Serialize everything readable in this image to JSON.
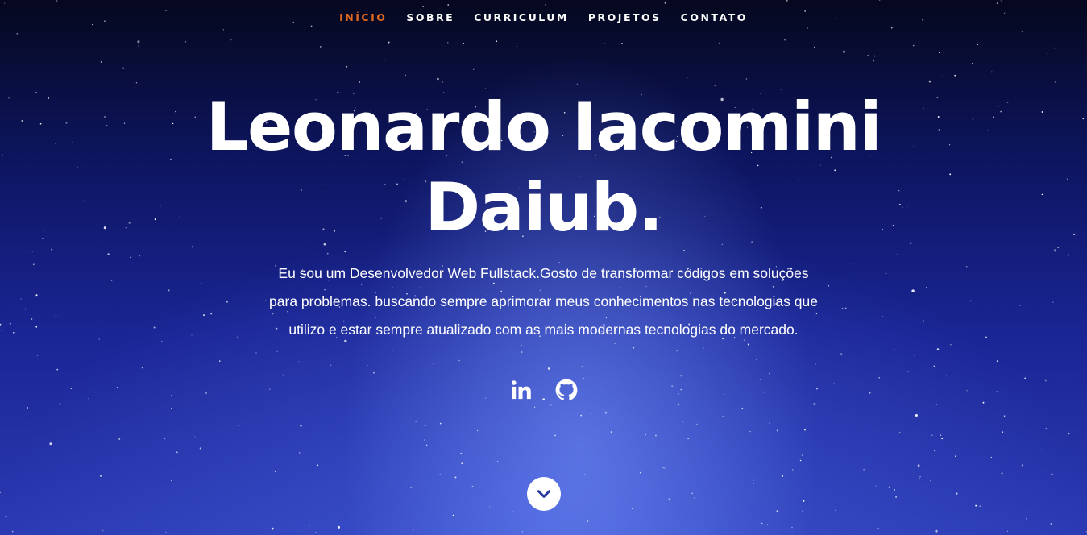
{
  "nav": {
    "items": [
      {
        "label": "INÍCIO",
        "active": true
      },
      {
        "label": "SOBRE",
        "active": false
      },
      {
        "label": "CURRICULUM",
        "active": false
      },
      {
        "label": "PROJETOS",
        "active": false
      },
      {
        "label": "CONTATO",
        "active": false
      }
    ],
    "active_color": "#e0691f"
  },
  "hero": {
    "name_line1": "Leonardo Iacomini",
    "name_line2": "Daiub.",
    "bio_line1": "Eu sou um Desenvolvedor Web Fullstack.Gosto de transformar códigos em soluções",
    "bio_line2": "para problemas. buscando sempre aprimorar meus conhecimentos nas tecnologias que",
    "bio_line3": "utilizo e estar sempre atualizado com as mais modernas tecnologias do mercado."
  },
  "social": [
    {
      "icon": "linkedin-icon"
    },
    {
      "icon": "github-icon"
    }
  ],
  "scroll": {
    "icon": "chevron-down-icon"
  },
  "colors": {
    "background": "#1a2594",
    "text": "#ffffff",
    "accent": "#e0691f"
  }
}
